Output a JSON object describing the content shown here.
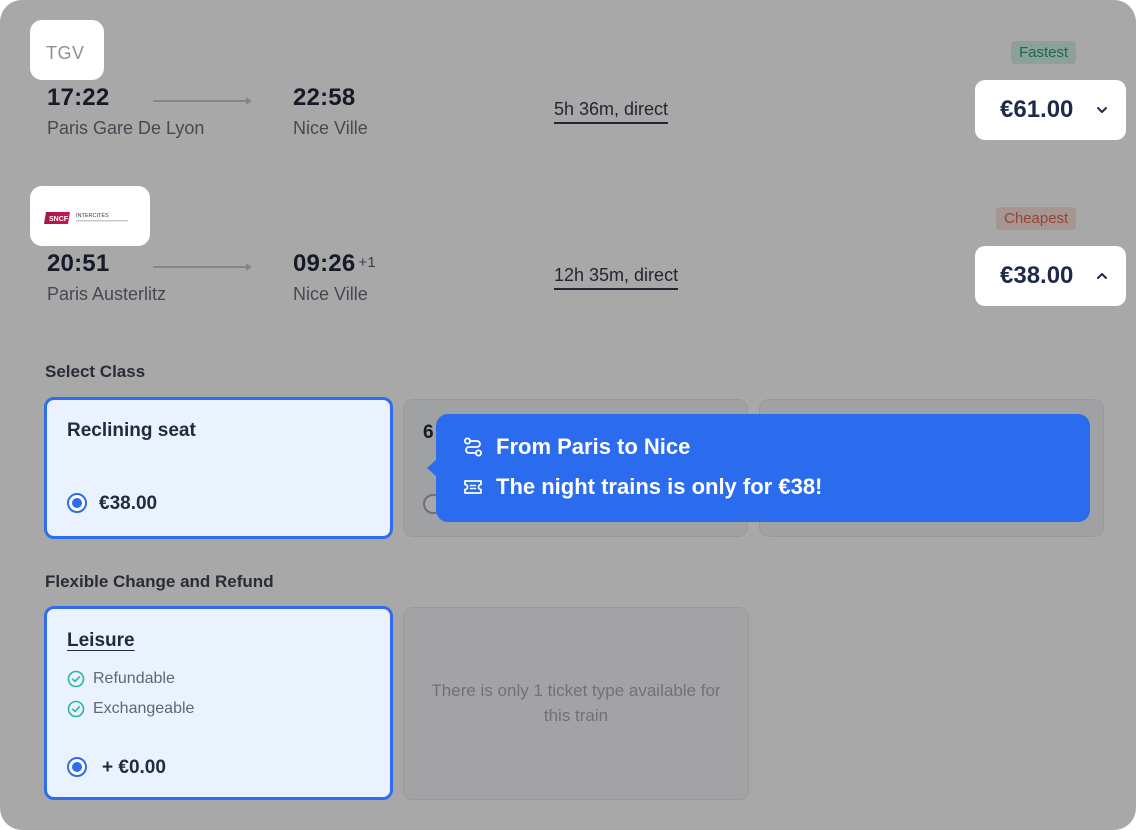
{
  "trains": [
    {
      "operator": "TGV",
      "depart_time": "17:22",
      "depart_station": "Paris Gare De Lyon",
      "arrive_time": "22:58",
      "arrive_station": "Nice Ville",
      "duration": "5h 36m, direct",
      "tag": "Fastest",
      "price": "€61.00",
      "chevron": "chevron-down-icon"
    },
    {
      "operator_logo": "SNCF Intercités",
      "depart_time": "20:51",
      "depart_station": "Paris Austerlitz",
      "arrive_time": "09:26",
      "arrive_day_offset": "+1",
      "arrive_station": "Nice Ville",
      "duration": "12h 35m, direct",
      "tag": "Cheapest",
      "price": "€38.00",
      "chevron": "chevron-up-icon"
    }
  ],
  "select_class": {
    "title": "Select Class",
    "options": [
      {
        "name": "Reclining seat",
        "price": "€38.00",
        "selected": true
      },
      {
        "name": "6",
        "selected": false
      }
    ]
  },
  "flexible": {
    "title": "Flexible Change and Refund",
    "option": {
      "name": "Leisure",
      "features": [
        "Refundable",
        "Exchangeable"
      ],
      "price": "+ €0.00"
    },
    "note": "There is only 1 ticket type available for this train"
  },
  "tooltip": {
    "line1": "From Paris to Nice",
    "line2": "The night trains is only for €38!",
    "icons": [
      "route-icon",
      "ticket-icon"
    ]
  },
  "colors": {
    "accent": "#2f6cf0",
    "tooltip": "#2a6ced",
    "fastest": "#2c9d7e",
    "cheapest": "#e06a52"
  }
}
